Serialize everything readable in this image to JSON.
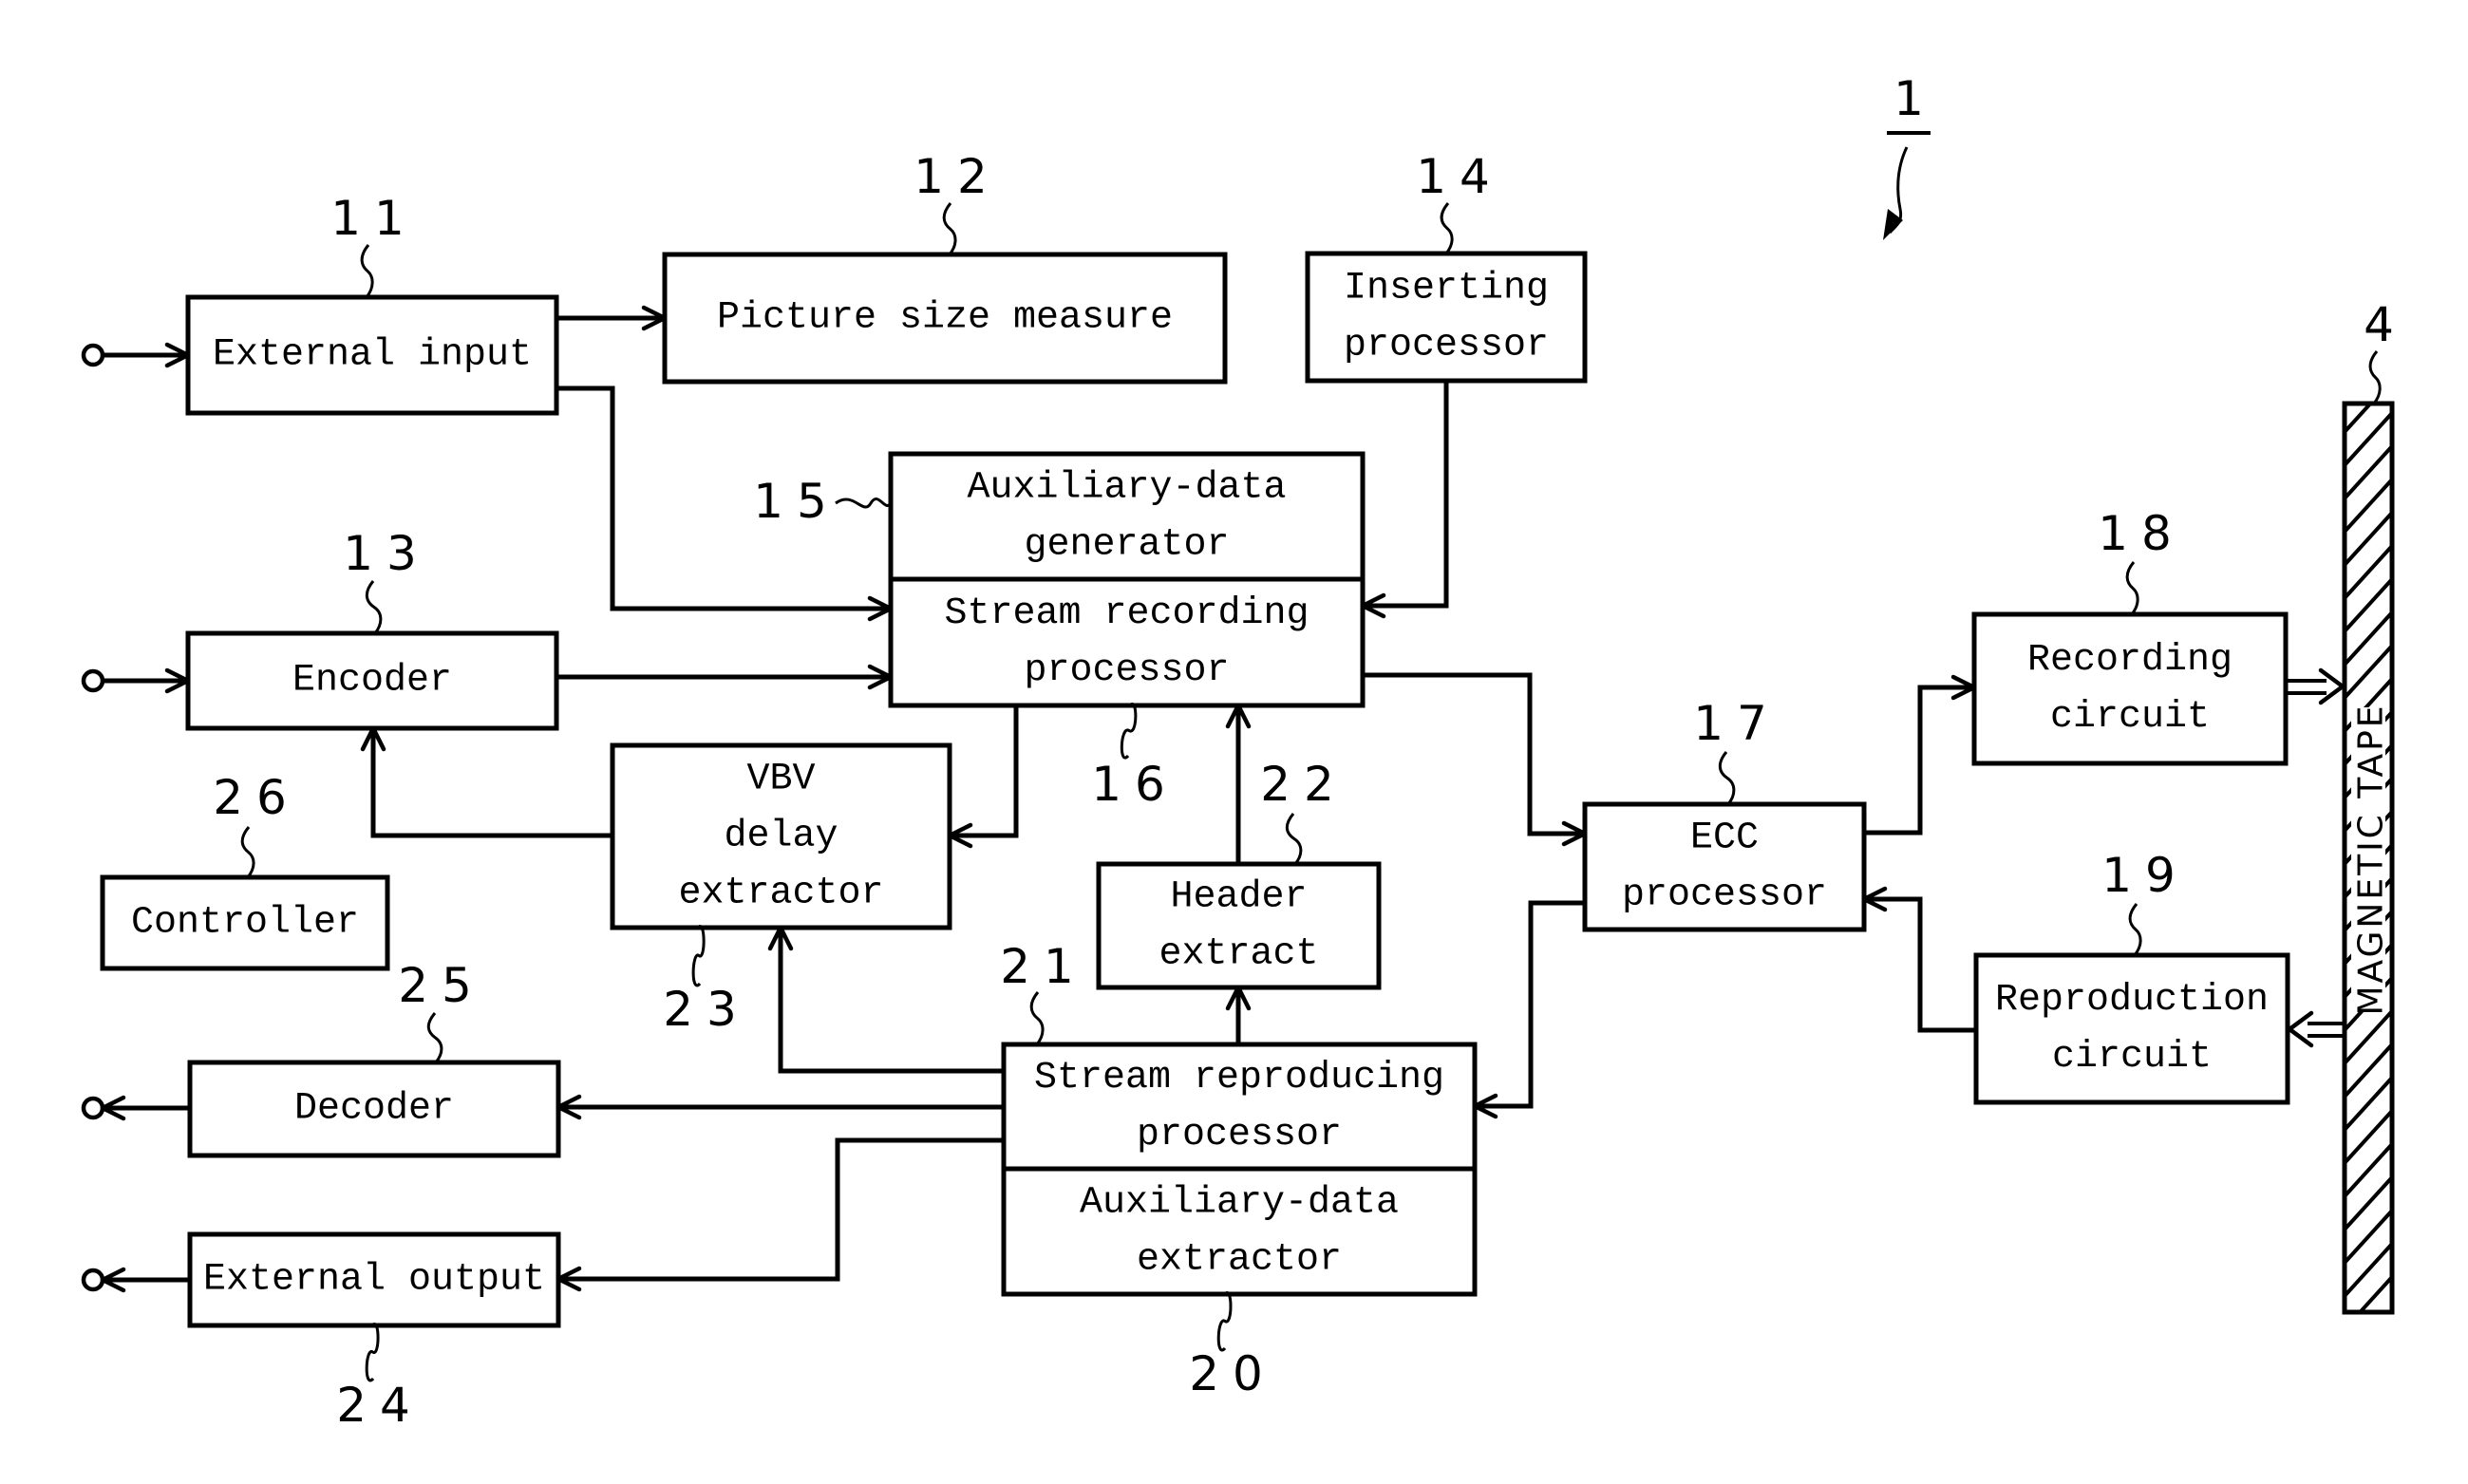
{
  "figure": {
    "system_ref": "1",
    "tape_ref": "4",
    "tape_label": "MAGNETIC TAPE"
  },
  "blocks": {
    "external_input": {
      "ref": "11",
      "lines": [
        "External input"
      ]
    },
    "picture_size": {
      "ref": "12",
      "lines": [
        "Picture size measure"
      ]
    },
    "encoder": {
      "ref": "13",
      "lines": [
        "Encoder"
      ]
    },
    "inserting": {
      "ref": "14",
      "lines": [
        "Inserting",
        "processor"
      ]
    },
    "aux_generator": {
      "ref": "15",
      "lines": [
        "Auxiliary-data",
        "generator"
      ]
    },
    "stream_recording": {
      "ref": "16",
      "lines": [
        "Stream recording",
        "processor"
      ]
    },
    "ecc": {
      "ref": "17",
      "lines": [
        "ECC",
        "processor"
      ]
    },
    "recording_circuit": {
      "ref": "18",
      "lines": [
        "Recording",
        "circuit"
      ]
    },
    "reproduction_circuit": {
      "ref": "19",
      "lines": [
        "Reproduction",
        "circuit"
      ]
    },
    "aux_extractor": {
      "ref": "20",
      "lines": [
        "Auxiliary-data",
        "extractor"
      ]
    },
    "stream_reproducing": {
      "ref": "21",
      "lines": [
        "Stream reproducing",
        "processor"
      ]
    },
    "header_extract": {
      "ref": "22",
      "lines": [
        "Header",
        "extract"
      ]
    },
    "vbv_delay": {
      "ref": "23",
      "lines": [
        "VBV",
        "delay",
        "extractor"
      ]
    },
    "external_output": {
      "ref": "24",
      "lines": [
        "External output"
      ]
    },
    "decoder": {
      "ref": "25",
      "lines": [
        "Decoder"
      ]
    },
    "controller": {
      "ref": "26",
      "lines": [
        "Controller"
      ]
    }
  },
  "icons": {
    "input_terminal": "input-terminal-icon",
    "output_terminal": "output-terminal-icon",
    "arrow": "arrow-icon",
    "double_arrow": "double-arrow-icon",
    "hatched_tape": "magnetic-tape-icon"
  }
}
